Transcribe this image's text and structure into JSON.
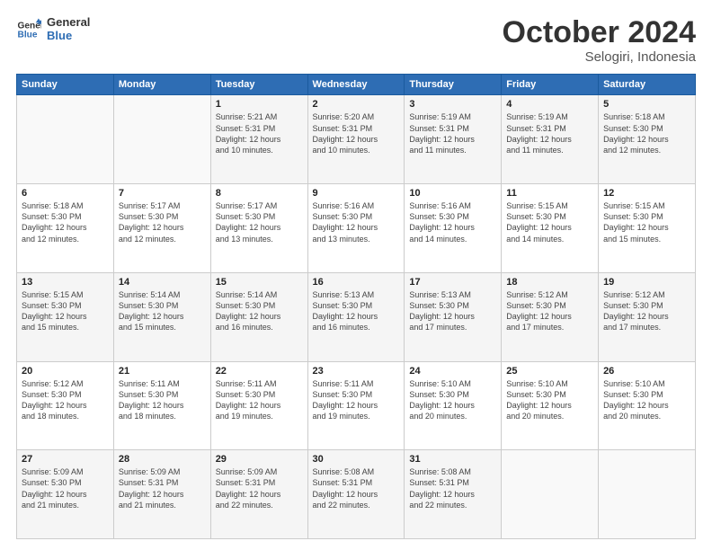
{
  "header": {
    "logo_line1": "General",
    "logo_line2": "Blue",
    "title": "October 2024",
    "subtitle": "Selogiri, Indonesia"
  },
  "days_of_week": [
    "Sunday",
    "Monday",
    "Tuesday",
    "Wednesday",
    "Thursday",
    "Friday",
    "Saturday"
  ],
  "weeks": [
    [
      {
        "day": "",
        "info": ""
      },
      {
        "day": "",
        "info": ""
      },
      {
        "day": "1",
        "info": "Sunrise: 5:21 AM\nSunset: 5:31 PM\nDaylight: 12 hours\nand 10 minutes."
      },
      {
        "day": "2",
        "info": "Sunrise: 5:20 AM\nSunset: 5:31 PM\nDaylight: 12 hours\nand 10 minutes."
      },
      {
        "day": "3",
        "info": "Sunrise: 5:19 AM\nSunset: 5:31 PM\nDaylight: 12 hours\nand 11 minutes."
      },
      {
        "day": "4",
        "info": "Sunrise: 5:19 AM\nSunset: 5:31 PM\nDaylight: 12 hours\nand 11 minutes."
      },
      {
        "day": "5",
        "info": "Sunrise: 5:18 AM\nSunset: 5:30 PM\nDaylight: 12 hours\nand 12 minutes."
      }
    ],
    [
      {
        "day": "6",
        "info": "Sunrise: 5:18 AM\nSunset: 5:30 PM\nDaylight: 12 hours\nand 12 minutes."
      },
      {
        "day": "7",
        "info": "Sunrise: 5:17 AM\nSunset: 5:30 PM\nDaylight: 12 hours\nand 12 minutes."
      },
      {
        "day": "8",
        "info": "Sunrise: 5:17 AM\nSunset: 5:30 PM\nDaylight: 12 hours\nand 13 minutes."
      },
      {
        "day": "9",
        "info": "Sunrise: 5:16 AM\nSunset: 5:30 PM\nDaylight: 12 hours\nand 13 minutes."
      },
      {
        "day": "10",
        "info": "Sunrise: 5:16 AM\nSunset: 5:30 PM\nDaylight: 12 hours\nand 14 minutes."
      },
      {
        "day": "11",
        "info": "Sunrise: 5:15 AM\nSunset: 5:30 PM\nDaylight: 12 hours\nand 14 minutes."
      },
      {
        "day": "12",
        "info": "Sunrise: 5:15 AM\nSunset: 5:30 PM\nDaylight: 12 hours\nand 15 minutes."
      }
    ],
    [
      {
        "day": "13",
        "info": "Sunrise: 5:15 AM\nSunset: 5:30 PM\nDaylight: 12 hours\nand 15 minutes."
      },
      {
        "day": "14",
        "info": "Sunrise: 5:14 AM\nSunset: 5:30 PM\nDaylight: 12 hours\nand 15 minutes."
      },
      {
        "day": "15",
        "info": "Sunrise: 5:14 AM\nSunset: 5:30 PM\nDaylight: 12 hours\nand 16 minutes."
      },
      {
        "day": "16",
        "info": "Sunrise: 5:13 AM\nSunset: 5:30 PM\nDaylight: 12 hours\nand 16 minutes."
      },
      {
        "day": "17",
        "info": "Sunrise: 5:13 AM\nSunset: 5:30 PM\nDaylight: 12 hours\nand 17 minutes."
      },
      {
        "day": "18",
        "info": "Sunrise: 5:12 AM\nSunset: 5:30 PM\nDaylight: 12 hours\nand 17 minutes."
      },
      {
        "day": "19",
        "info": "Sunrise: 5:12 AM\nSunset: 5:30 PM\nDaylight: 12 hours\nand 17 minutes."
      }
    ],
    [
      {
        "day": "20",
        "info": "Sunrise: 5:12 AM\nSunset: 5:30 PM\nDaylight: 12 hours\nand 18 minutes."
      },
      {
        "day": "21",
        "info": "Sunrise: 5:11 AM\nSunset: 5:30 PM\nDaylight: 12 hours\nand 18 minutes."
      },
      {
        "day": "22",
        "info": "Sunrise: 5:11 AM\nSunset: 5:30 PM\nDaylight: 12 hours\nand 19 minutes."
      },
      {
        "day": "23",
        "info": "Sunrise: 5:11 AM\nSunset: 5:30 PM\nDaylight: 12 hours\nand 19 minutes."
      },
      {
        "day": "24",
        "info": "Sunrise: 5:10 AM\nSunset: 5:30 PM\nDaylight: 12 hours\nand 20 minutes."
      },
      {
        "day": "25",
        "info": "Sunrise: 5:10 AM\nSunset: 5:30 PM\nDaylight: 12 hours\nand 20 minutes."
      },
      {
        "day": "26",
        "info": "Sunrise: 5:10 AM\nSunset: 5:30 PM\nDaylight: 12 hours\nand 20 minutes."
      }
    ],
    [
      {
        "day": "27",
        "info": "Sunrise: 5:09 AM\nSunset: 5:30 PM\nDaylight: 12 hours\nand 21 minutes."
      },
      {
        "day": "28",
        "info": "Sunrise: 5:09 AM\nSunset: 5:31 PM\nDaylight: 12 hours\nand 21 minutes."
      },
      {
        "day": "29",
        "info": "Sunrise: 5:09 AM\nSunset: 5:31 PM\nDaylight: 12 hours\nand 22 minutes."
      },
      {
        "day": "30",
        "info": "Sunrise: 5:08 AM\nSunset: 5:31 PM\nDaylight: 12 hours\nand 22 minutes."
      },
      {
        "day": "31",
        "info": "Sunrise: 5:08 AM\nSunset: 5:31 PM\nDaylight: 12 hours\nand 22 minutes."
      },
      {
        "day": "",
        "info": ""
      },
      {
        "day": "",
        "info": ""
      }
    ]
  ]
}
